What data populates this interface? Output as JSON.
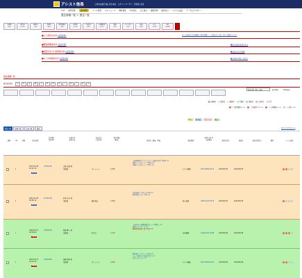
{
  "header": {
    "app_title": "アシスト信長",
    "company_line": "三井住友銀行(株) 東京本社　ログインユーザー：管理者 太郎"
  },
  "nav": [
    "TOP",
    "案件管理",
    "受注管理",
    "メール管理",
    "スケジュール",
    "物件検索",
    "FAX送信",
    "売上集計",
    "顧客管理",
    "帳票出力",
    "システム設定",
    "データエクスポート"
  ],
  "page": {
    "title": "受注詳細一覧 ＞ 受注一覧"
  },
  "status_tabs": [
    {
      "label": "未処理",
      "count": "(0件)"
    },
    {
      "label": "受付済",
      "count": "(12件)"
    },
    {
      "label": "確認中",
      "count": "(3件)"
    },
    {
      "label": "手配済",
      "count": "(8件)"
    },
    {
      "label": "発送準備中",
      "count": "(5件)"
    },
    {
      "label": "発送済",
      "count": "(22件)"
    },
    {
      "label": "入金待ち",
      "count": "(4件)"
    },
    {
      "label": "入金確認済",
      "count": "(16件)"
    },
    {
      "label": "保留",
      "count": "(2件)"
    },
    {
      "label": "キャンセル",
      "count": "(1件)"
    },
    {
      "label": "返品",
      "count": "(0件)"
    },
    {
      "label": "完了",
      "count": "(31件)"
    },
    {
      "label": "全件",
      "count": "(104件)"
    }
  ],
  "notices": {
    "right_link": "※このお知らせの詳細は「受注管理」→「お知らせ一覧」からご確認ください",
    "items": [
      {
        "title": "■ご入金待ちの方",
        "link": "[該当6件]"
      },
      {
        "title": "■発送準備中の方",
        "link": "[該当3件]"
      },
      {
        "title": "■指定日までに未到着の方",
        "link": "[該当2件]"
      },
      {
        "title": "■メール未送信の方",
        "link": "[該当4件]"
      }
    ],
    "right_links": [
      "■本日の受注を表示する",
      "■お問い合わせ管理",
      "■出荷指示書を一括出力"
    ]
  },
  "list": {
    "section_label": "受注詳細一覧",
    "filter_label": "受注状況別",
    "filter_buttons": [
      "全",
      "未",
      "受",
      "確",
      "手",
      "準",
      "発",
      "待",
      "入",
      "保",
      "キ",
      "返",
      "完"
    ],
    "sort_label": "並び替え",
    "sort_value": "受注日時（新しい順）",
    "per_page": "20件表示"
  },
  "legend": [
    {
      "label": "未処理",
      "color": "#ffffff"
    },
    {
      "label": "受付済",
      "color": "#fde4bd"
    },
    {
      "label": "確認中",
      "color": "#f7f3a0"
    },
    {
      "label": "手配済",
      "color": "#b8f2ad"
    },
    {
      "label": "発送済",
      "color": "#a9d3f5"
    },
    {
      "label": "入金待ち",
      "color": "#f6b7b7"
    },
    {
      "label": "完了",
      "color": "#d9d9d9"
    }
  ],
  "legend2": [
    {
      "label": "○ 受注確認メール",
      "color": "#e26b6b"
    },
    {
      "label": "○ 発送完了メール",
      "color": "#e26b6b"
    },
    {
      "label": "○ 入金確認メール",
      "color": "#e26b6b"
    },
    {
      "label": "○ お礼メール",
      "color": "#c8c8c8"
    }
  ],
  "legend3": [
    "代引き",
    "銀行振込",
    "クレジット",
    "後払い"
  ],
  "pagination": "[1] 2 3 4 5 次へ ≫",
  "table_tabs": [
    "受注一覧",
    "出荷一覧",
    "入金一覧",
    "集計"
  ],
  "columns": [
    "選択",
    "No",
    "状態",
    "受注日時",
    "注文番号\n(受注ID)",
    "お届け先\n配送方法",
    "支払方法\n入金状況",
    "受注金額\n(税込)",
    "商品名／数量／単価",
    "配送業者",
    "お問い合わせ\n伝票番号",
    "発送予定日",
    "発送日",
    "お届け指定日",
    "備考",
    "メール送信"
  ],
  "rows": [
    {
      "status": "受付済",
      "no": "1",
      "date": "2024-05-28\n10:21:33",
      "order_id": "(2306145)",
      "customer": "山田 太郎 様",
      "ship": "宅配便",
      "pay": "クレジット",
      "amount": "5,280",
      "items": [
        "【送料無料】ドライフルーツ詰め合わせ 500g ×1",
        "国産ミックスナッツ 300g ×2",
        "有機ルイボスティー 20包 ×1"
      ],
      "carrier": "ヤマト運輸",
      "tracking": "4521-8830-2214",
      "due": "2024/05/30",
      "shipped": "2024/05/29",
      "color": "orange"
    },
    {
      "status": "受付済",
      "no": "2",
      "date": "2024-05-28\n09:58:10",
      "order_id": "(2306144)",
      "customer": "鈴木 花子 様",
      "ship": "宅配便",
      "pay": "銀行振込",
      "amount": "3,960",
      "items": [
        "北海道産じゃがいも 5kg ×1",
        "熊本県産トマト 2kg ×1"
      ],
      "carrier": "佐川急便",
      "tracking": "3382-1104-5579",
      "due": "2024/05/31",
      "shipped": "2024/05/30",
      "color": "orange"
    },
    {
      "status": "手配済",
      "no": "3",
      "date": "2024-05-27\n18:45:02",
      "order_id": "(2306143)",
      "customer": "佐藤 健一 様",
      "ship": "宅配便",
      "pay": "代引き",
      "amount": "7,150",
      "items": [
        "【お中元】老舗和菓子セット 12個入 ×1",
        "抹茶ロールケーキ ×1",
        "静岡県産深蒸し茶 100g ×3"
      ],
      "carrier": "日本郵便",
      "tracking": "1209-4471-3306",
      "due": "2024/05/29",
      "shipped": "2024/05/28",
      "color": "green"
    },
    {
      "status": "手配済",
      "no": "4",
      "date": "2024-05-27\n16:12:44",
      "order_id": "(2306142)",
      "customer": "高橋 美咲 様",
      "ship": "宅配便",
      "pay": "クレジット",
      "amount": "4,400",
      "items": [
        "無添加ドッグフード 2kg ×1",
        "ペット用おやつ詰め合わせ ×2",
        "お手入れブラシ ×1"
      ],
      "carrier": "ヤマト運輸",
      "tracking": "4521-8830-2190",
      "due": "2024/05/29",
      "shipped": "2024/05/28",
      "color": "green"
    }
  ]
}
